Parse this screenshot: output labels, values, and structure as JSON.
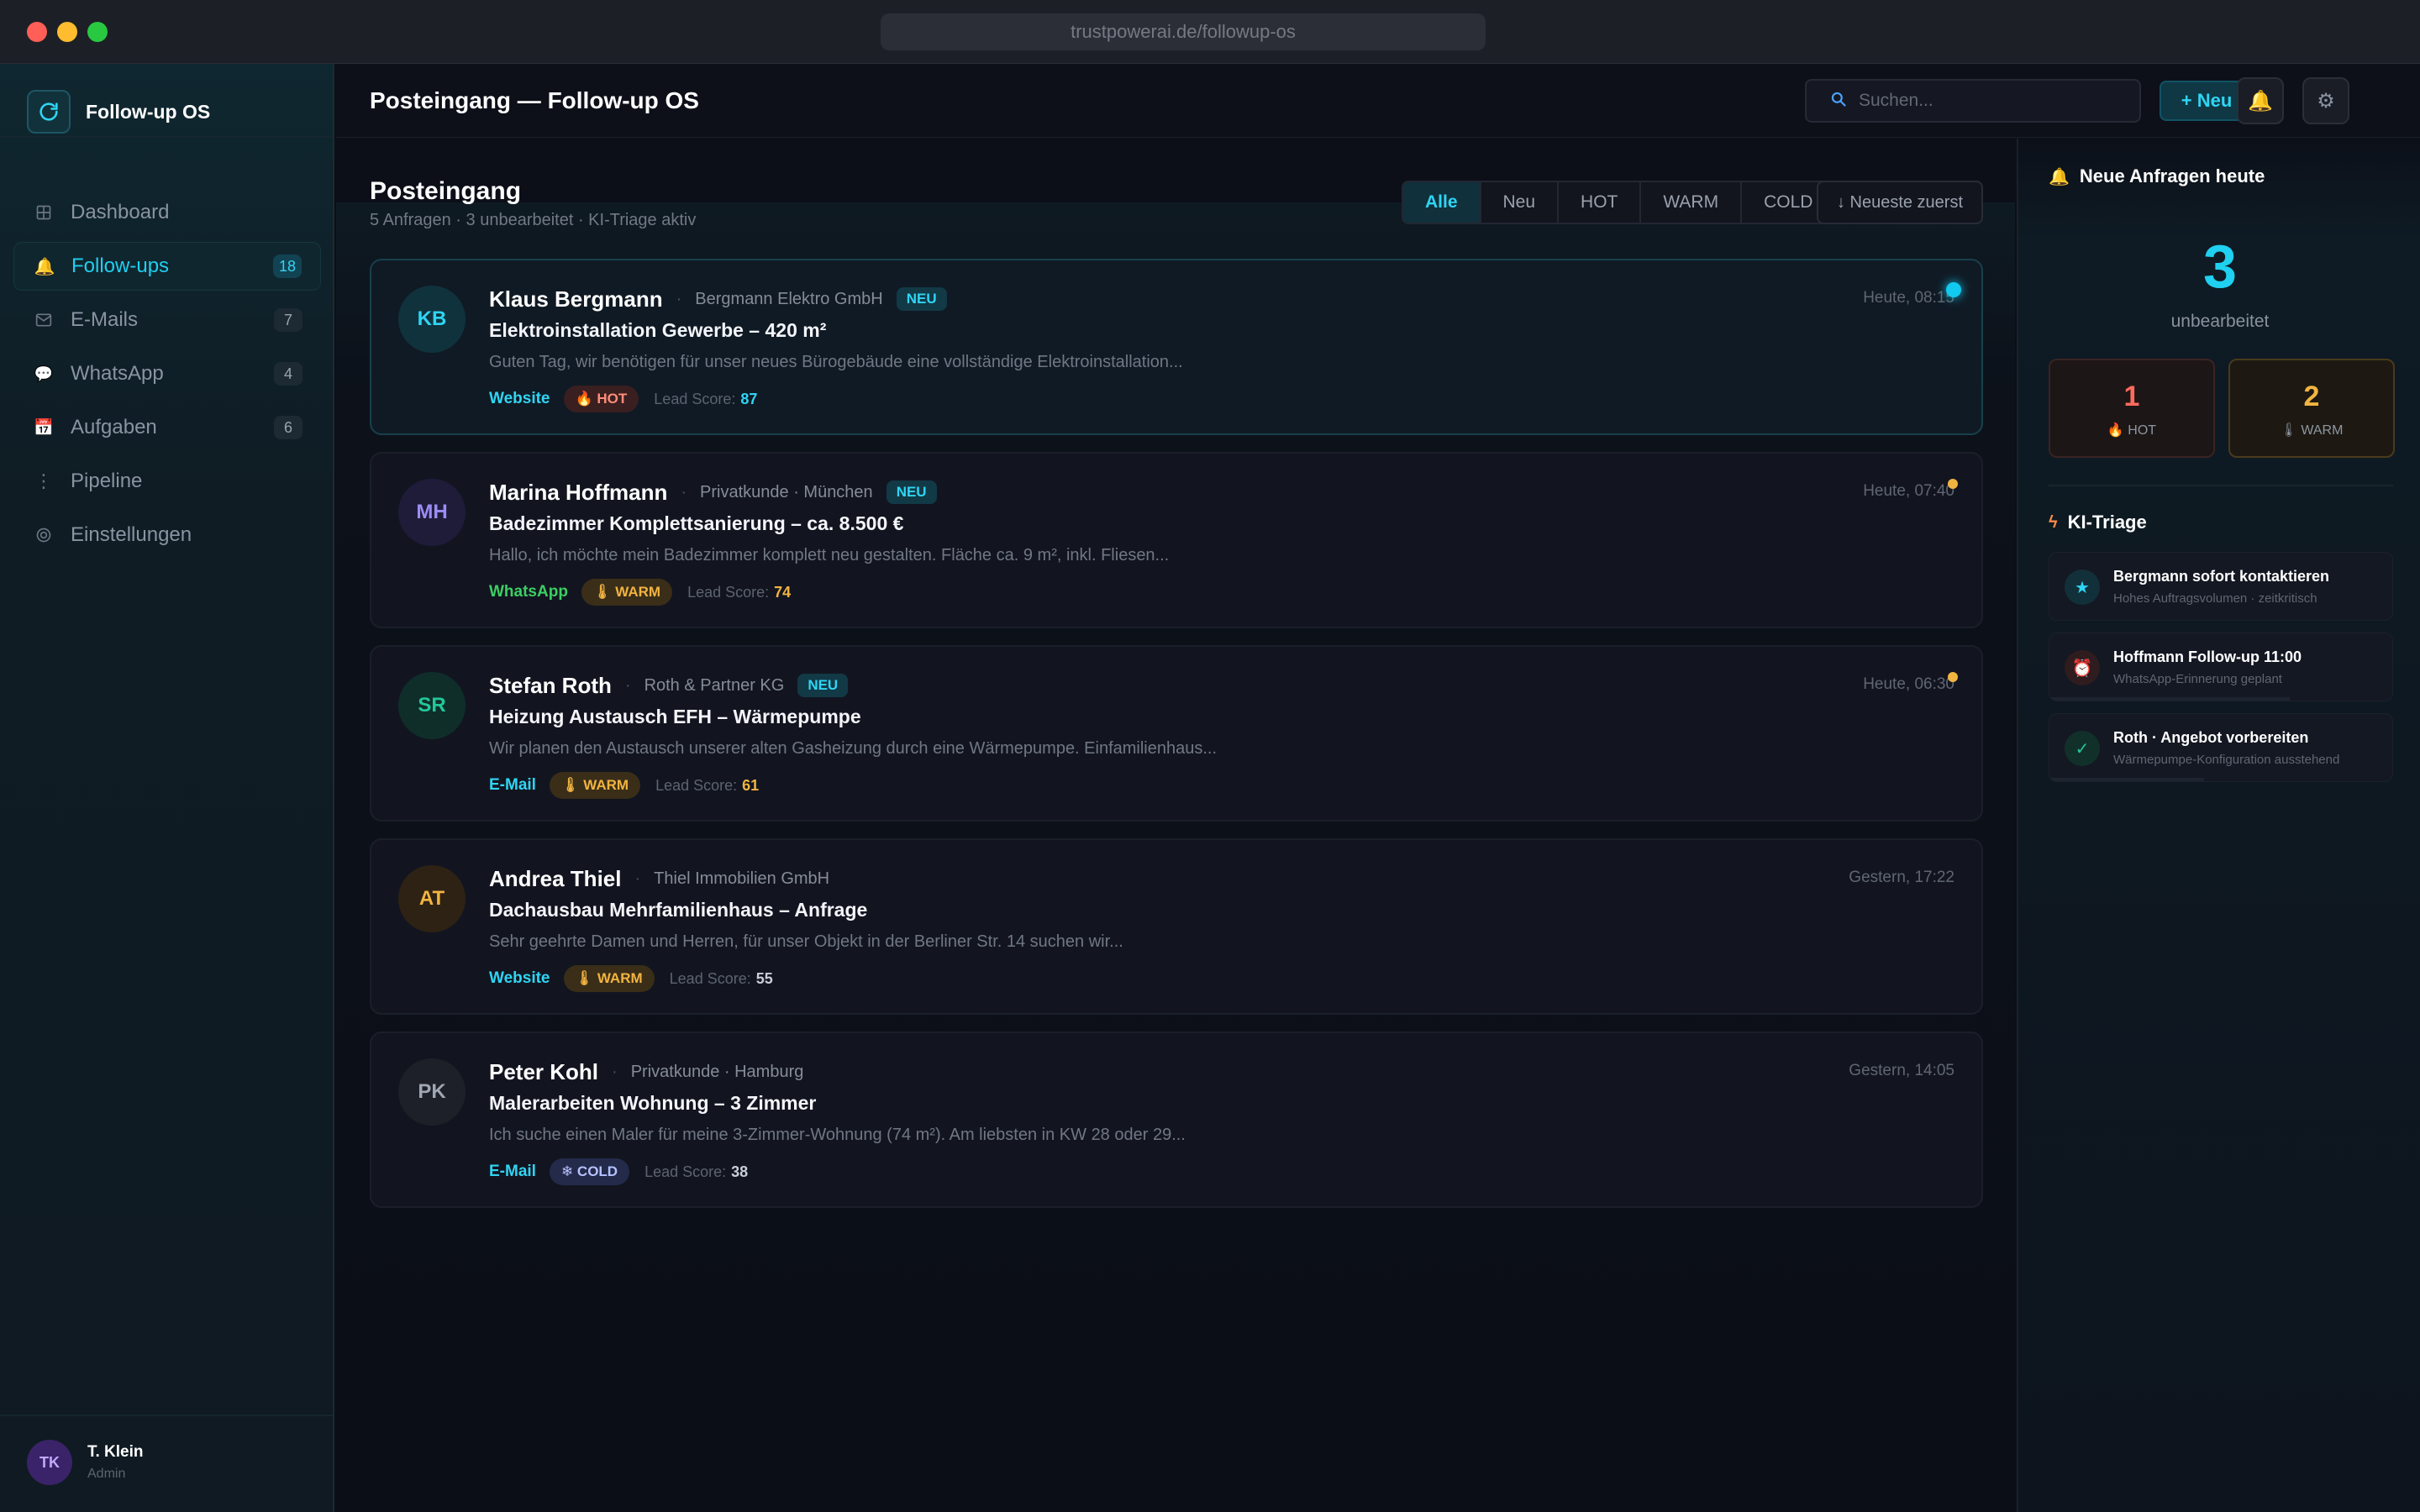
{
  "browser": {
    "url": "trustpowerai.de/followup-os"
  },
  "brand": {
    "name": "Follow-up OS"
  },
  "nav": [
    {
      "label": "Dashboard",
      "icon": "grid-icon",
      "count": null,
      "active": false
    },
    {
      "label": "Follow-ups",
      "icon": "bell-icon",
      "count": "18",
      "active": true
    },
    {
      "label": "E-Mails",
      "icon": "mail-icon",
      "count": "7",
      "active": false
    },
    {
      "label": "WhatsApp",
      "icon": "chat-icon",
      "count": "4",
      "active": false
    },
    {
      "label": "Aufgaben",
      "icon": "calendar-icon",
      "count": "6",
      "active": false
    },
    {
      "label": "Pipeline",
      "icon": "dots-icon",
      "count": null,
      "active": false
    },
    {
      "label": "Einstellungen",
      "icon": "gear-icon",
      "count": null,
      "active": false
    }
  ],
  "user": {
    "initials": "TK",
    "name": "T. Klein",
    "role": "Admin"
  },
  "header": {
    "title": "Posteingang — Follow-up OS",
    "search_placeholder": "Suchen...",
    "new_label": "+ Neu"
  },
  "inbox": {
    "title": "Posteingang",
    "subtitle": "5 Anfragen · 3 unbearbeitet · KI-Triage aktiv",
    "filters": [
      "Alle",
      "Neu",
      "HOT",
      "WARM",
      "COLD"
    ],
    "active_filter": "Alle",
    "sort_label": "↓ Neueste zuerst",
    "items": [
      {
        "initials": "KB",
        "name": "Klaus Bergmann",
        "company": "Bergmann Elektro GmbH",
        "badge": "NEU",
        "time": "Heute, 08:15",
        "subject": "Elektroinstallation Gewerbe – 420 m²",
        "preview": "Guten Tag, wir benötigen für unser neues Bürogebäude eine vollständige Elektroinstallation...",
        "channel": "Website",
        "temperature": "HOT",
        "temp_label": "🔥 HOT",
        "score_label": "Lead Score:",
        "score": "87",
        "avatar_bg": "#10323d",
        "avatar_fg": "#2fd5f4",
        "channel_color": "#2fd5f4",
        "score_color": "#2fd5f4",
        "unread_color": "#12c9f0",
        "selected": true
      },
      {
        "initials": "MH",
        "name": "Marina Hoffmann",
        "company": "Privatkunde · München",
        "badge": "NEU",
        "time": "Heute, 07:40",
        "subject": "Badezimmer Komplettsanierung – ca. 8.500 €",
        "preview": "Hallo, ich möchte mein Badezimmer komplett neu gestalten. Fläche ca. 9 m², inkl. Fliesen...",
        "channel": "WhatsApp",
        "temperature": "WARM",
        "temp_label": "🌡 WARM",
        "score_label": "Lead Score:",
        "score": "74",
        "avatar_bg": "#1f1c3a",
        "avatar_fg": "#9d8cf5",
        "channel_color": "#3ccf63",
        "score_color": "#f2b441",
        "unread_color": "#f2b441",
        "selected": false
      },
      {
        "initials": "SR",
        "name": "Stefan Roth",
        "company": "Roth & Partner KG",
        "badge": "NEU",
        "time": "Heute, 06:30",
        "subject": "Heizung Austausch EFH – Wärmepumpe",
        "preview": "Wir planen den Austausch unserer alten Gasheizung durch eine Wärmepumpe. Einfamilienhaus...",
        "channel": "E-Mail",
        "temperature": "WARM",
        "temp_label": "🌡 WARM",
        "score_label": "Lead Score:",
        "score": "61",
        "avatar_bg": "#0f2e2a",
        "avatar_fg": "#22c79a",
        "channel_color": "#2fd5f4",
        "score_color": "#f2b441",
        "unread_color": "#f2b441",
        "selected": false
      },
      {
        "initials": "AT",
        "name": "Andrea Thiel",
        "company": "Thiel Immobilien GmbH",
        "badge": "",
        "time": "Gestern, 17:22",
        "subject": "Dachausbau Mehrfamilienhaus – Anfrage",
        "preview": "Sehr geehrte Damen und Herren, für unser Objekt in der Berliner Str. 14 suchen wir...",
        "channel": "Website",
        "temperature": "WARM",
        "temp_label": "🌡 WARM",
        "score_label": "Lead Score:",
        "score": "55",
        "avatar_bg": "#2e2214",
        "avatar_fg": "#f2b441",
        "channel_color": "#2fd5f4",
        "score_color": "#c9ced8",
        "unread_color": "",
        "selected": false
      },
      {
        "initials": "PK",
        "name": "Peter Kohl",
        "company": "Privatkunde · Hamburg",
        "badge": "",
        "time": "Gestern, 14:05",
        "subject": "Malerarbeiten Wohnung – 3 Zimmer",
        "preview": "Ich suche einen Maler für meine 3-Zimmer-Wohnung (74 m²). Am liebsten in KW 28 oder 29...",
        "channel": "E-Mail",
        "temperature": "COLD",
        "temp_label": "❄ COLD",
        "score_label": "Lead Score:",
        "score": "38",
        "avatar_bg": "#1d2029",
        "avatar_fg": "#a0a6b2",
        "channel_color": "#2fd5f4",
        "score_color": "#c9ced8",
        "unread_color": "",
        "selected": false
      }
    ]
  },
  "panel": {
    "today_title": "Neue Anfragen heute",
    "today_count": "3",
    "today_label": "unbearbeitet",
    "hot_count": "1",
    "hot_label": "🔥 HOT",
    "warm_count": "2",
    "warm_label": "🌡 WARM",
    "triage_title": "KI-Triage",
    "triage": [
      {
        "title": "Bergmann sofort kontaktieren",
        "sub": "Hohes Auftragsvolumen · zeitkritisch",
        "icon": "star-icon",
        "glyph": "★",
        "color": "#2fd5f4",
        "bg": "#12303a",
        "progress": 0
      },
      {
        "title": "Hoffmann Follow-up 11:00",
        "sub": "WhatsApp-Erinnerung geplant",
        "icon": "alarm-icon",
        "glyph": "⏰",
        "color": "#ff8d7a",
        "bg": "#2f1c1e",
        "progress": 0.7
      },
      {
        "title": "Roth · Angebot vorbereiten",
        "sub": "Wärmepumpe-Konfiguration ausstehend",
        "icon": "check-icon",
        "glyph": "✓",
        "color": "#22c79a",
        "bg": "#12302a",
        "progress": 0.45
      }
    ]
  }
}
